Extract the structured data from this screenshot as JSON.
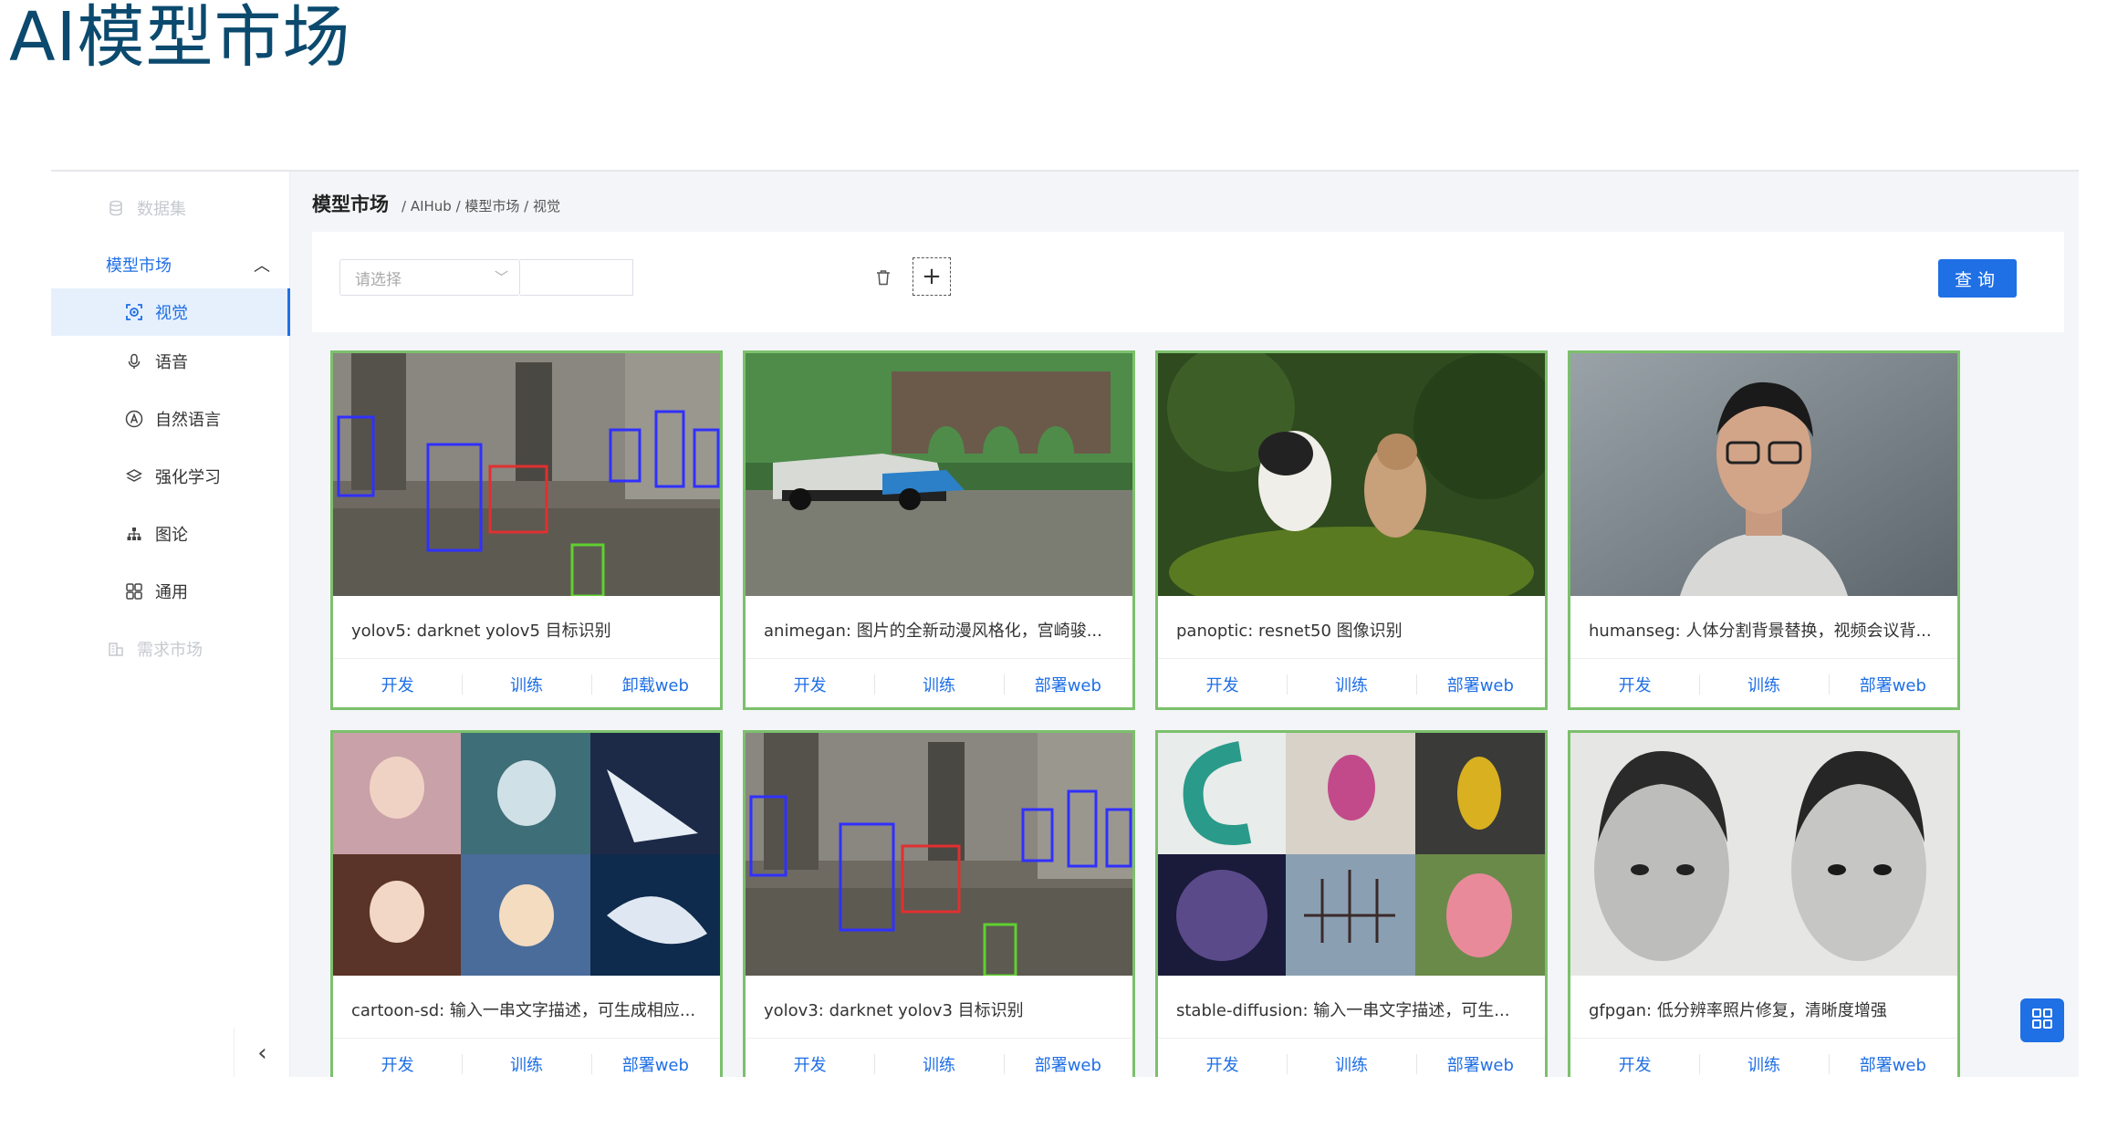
{
  "slide_title": "AI模型市场",
  "colors": {
    "accent": "#1f6fe5",
    "title": "#0b4a6e",
    "card_border": "#7cc06c",
    "active_bg": "#e6f0fd"
  },
  "sidebar": {
    "items": [
      {
        "label": "数据集",
        "icon": "database-icon",
        "state": "dim"
      },
      {
        "label": "模型市场",
        "icon": "",
        "state": "parent-expanded"
      },
      {
        "label": "视觉",
        "icon": "eye-scan-icon",
        "state": "active"
      },
      {
        "label": "语音",
        "icon": "microphone-icon",
        "state": "normal"
      },
      {
        "label": "自然语言",
        "icon": "letter-a-icon",
        "state": "normal"
      },
      {
        "label": "强化学习",
        "icon": "layers-icon",
        "state": "normal"
      },
      {
        "label": "图论",
        "icon": "graph-tree-icon",
        "state": "normal"
      },
      {
        "label": "通用",
        "icon": "grid-icon",
        "state": "normal"
      },
      {
        "label": "需求市场",
        "icon": "building-icon",
        "state": "dim"
      }
    ],
    "collapse_icon": "chevron-left-icon"
  },
  "breadcrumb": {
    "title": "模型市场",
    "path": "/ AIHub / 模型市场 / 视觉"
  },
  "toolbar": {
    "select_placeholder": "请选择",
    "query_label": "查询"
  },
  "cards": [
    {
      "title": "yolov5: darknet yolov5 目标识别",
      "actions": [
        "开发",
        "训练",
        "卸载web"
      ],
      "image": "detection-street-scene"
    },
    {
      "title": "animegan: 图片的全新动漫风格化，宫崎骏...",
      "actions": [
        "开发",
        "训练",
        "部署web"
      ],
      "image": "anime-landscape"
    },
    {
      "title": "panoptic: resnet50 图像识别",
      "actions": [
        "开发",
        "训练",
        "部署web"
      ],
      "image": "puppy-and-kitten"
    },
    {
      "title": "humanseg: 人体分割背景替换，视频会议背...",
      "actions": [
        "开发",
        "训练",
        "部署web"
      ],
      "image": "person-portrait"
    },
    {
      "title": "cartoon-sd: 输入一串文字描述，可生成相应...",
      "actions": [
        "开发",
        "训练",
        "部署web"
      ],
      "image": "anime-collage"
    },
    {
      "title": "yolov3: darknet yolov3 目标识别",
      "actions": [
        "开发",
        "训练",
        "部署web"
      ],
      "image": "detection-street-scene"
    },
    {
      "title": "stable-diffusion: 输入一串文字描述，可生...",
      "actions": [
        "开发",
        "训练",
        "部署web"
      ],
      "image": "art-collage"
    },
    {
      "title": "gfpgan: 低分辨率照片修复，清晰度增强",
      "actions": [
        "开发",
        "训练",
        "部署web"
      ],
      "image": "face-restore-pair"
    }
  ]
}
